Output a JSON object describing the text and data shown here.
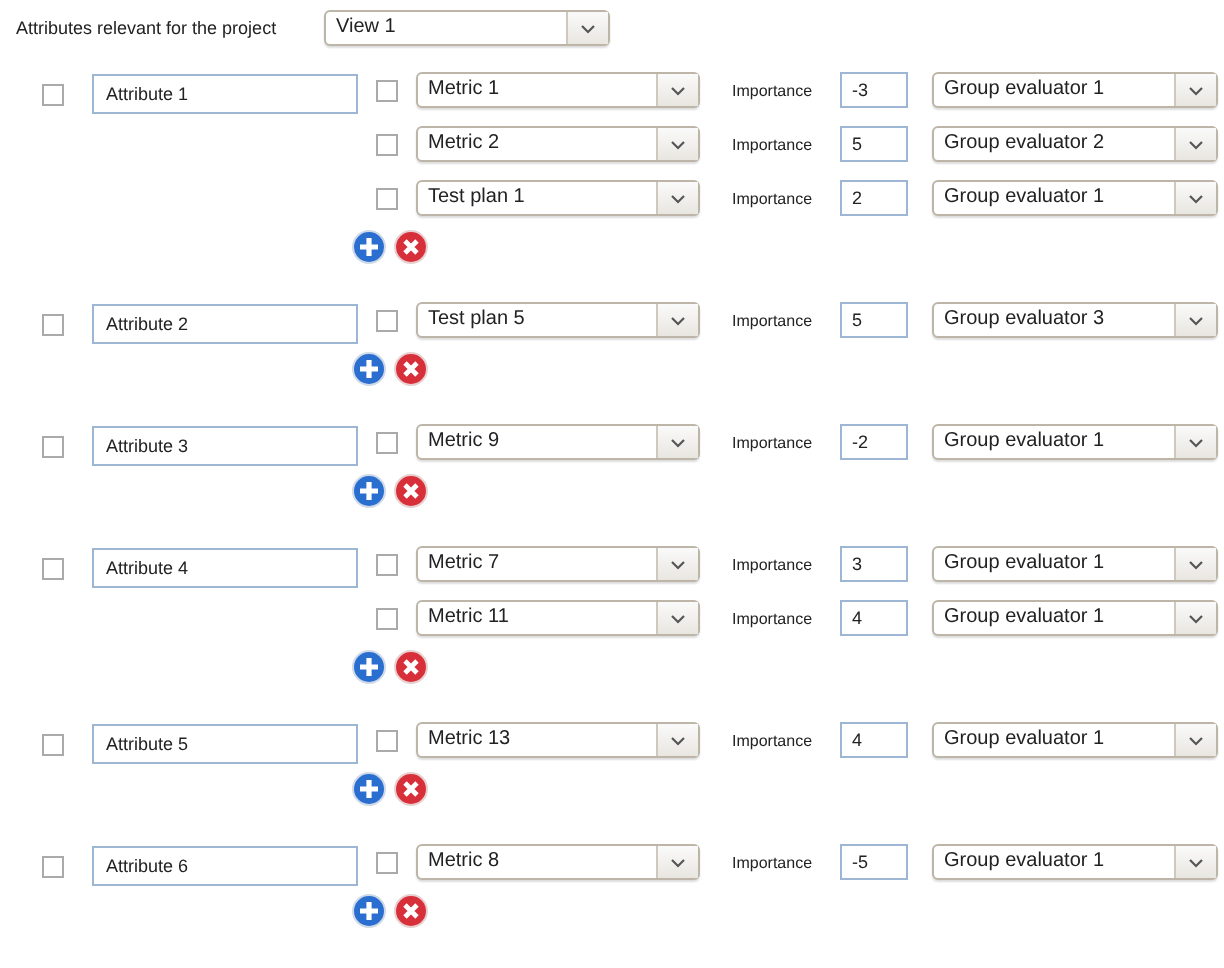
{
  "header": {
    "label": "Attributes relevant for the project",
    "view": "View 1"
  },
  "attributes": [
    {
      "checked": false,
      "name": "Attribute 1",
      "items": [
        {
          "checked": false,
          "value": "Metric 1",
          "importance_label": "Importance",
          "importance": "-3",
          "evaluator": "Group evaluator 1"
        },
        {
          "checked": false,
          "value": "Metric 2",
          "importance_label": "Importance",
          "importance": "5",
          "evaluator": "Group evaluator 2"
        },
        {
          "checked": false,
          "value": "Test plan 1",
          "importance_label": "Importance",
          "importance": "2",
          "evaluator": "Group evaluator 1"
        }
      ]
    },
    {
      "checked": false,
      "name": "Attribute 2",
      "items": [
        {
          "checked": false,
          "value": "Test plan 5",
          "importance_label": "Importance",
          "importance": "5",
          "evaluator": "Group evaluator 3"
        }
      ]
    },
    {
      "checked": false,
      "name": "Attribute 3",
      "items": [
        {
          "checked": false,
          "value": "Metric 9",
          "importance_label": "Importance",
          "importance": "-2",
          "evaluator": "Group evaluator 1"
        }
      ]
    },
    {
      "checked": false,
      "name": "Attribute 4",
      "items": [
        {
          "checked": false,
          "value": "Metric 7",
          "importance_label": "Importance",
          "importance": "3",
          "evaluator": "Group evaluator 1"
        },
        {
          "checked": false,
          "value": "Metric 11",
          "importance_label": "Importance",
          "importance": "4",
          "evaluator": "Group evaluator 1"
        }
      ]
    },
    {
      "checked": false,
      "name": "Attribute 5",
      "items": [
        {
          "checked": false,
          "value": "Metric 13",
          "importance_label": "Importance",
          "importance": "4",
          "evaluator": "Group evaluator 1"
        }
      ]
    },
    {
      "checked": false,
      "name": "Attribute 6",
      "items": [
        {
          "checked": false,
          "value": "Metric 8",
          "importance_label": "Importance",
          "importance": "-5",
          "evaluator": "Group evaluator 1"
        }
      ]
    }
  ]
}
